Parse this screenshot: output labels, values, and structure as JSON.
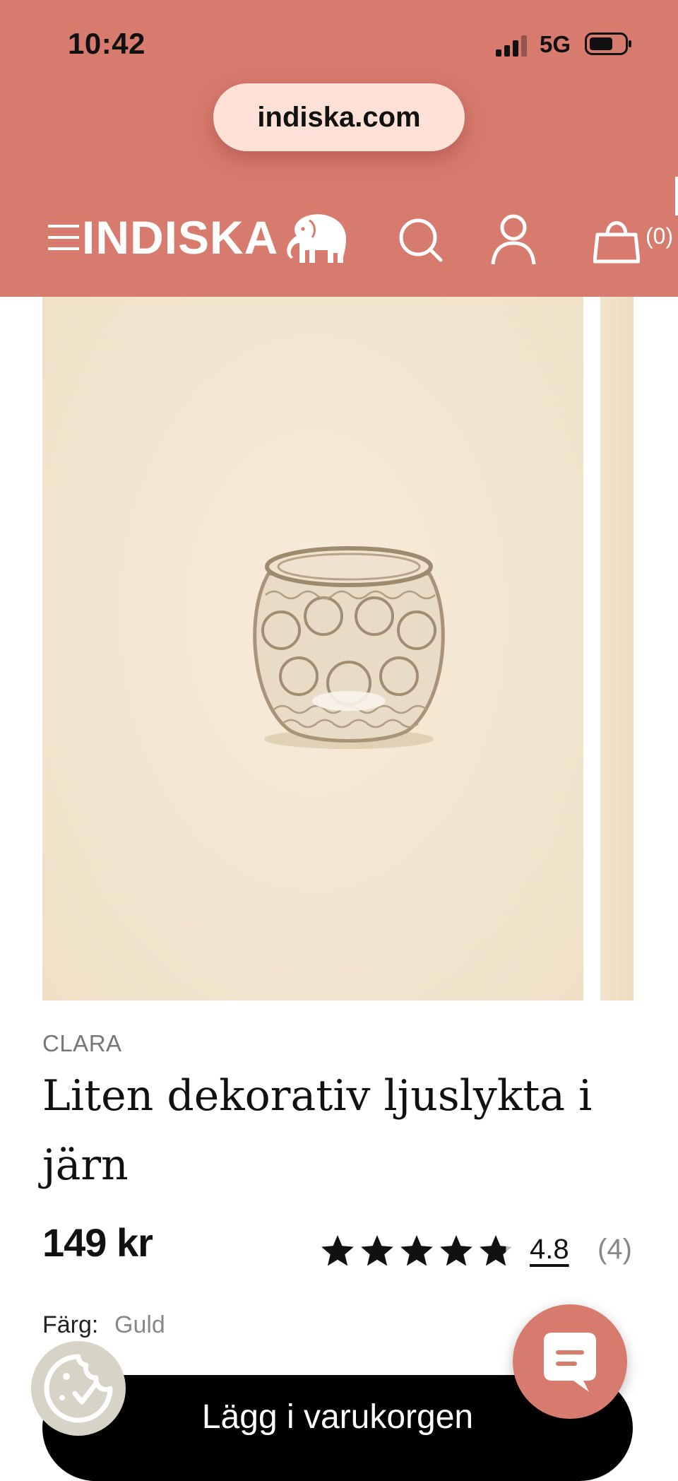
{
  "colors": {
    "brand": "#d87b6f",
    "pill": "#fde0d6",
    "cta": "#000000"
  },
  "status_bar": {
    "time": "10:42",
    "network": "5G"
  },
  "browser": {
    "url": "indiska.com"
  },
  "header": {
    "logo": "INDISKA",
    "cart_count": "(0)",
    "icons": [
      "menu-icon",
      "elephant-logo",
      "search-icon",
      "account-icon",
      "bag-icon"
    ]
  },
  "product": {
    "brand": "CLARA",
    "title": "Liten dekorativ ljuslykta i järn",
    "price": "149 kr",
    "rating": 4.8,
    "rating_value": "4.8",
    "review_count": "(4)",
    "color_label": "Färg:",
    "color_value": "Guld"
  },
  "actions": {
    "add_to_cart": "Lägg i varukorgen",
    "chat": "chat-icon",
    "cookie": "cookie-icon"
  }
}
